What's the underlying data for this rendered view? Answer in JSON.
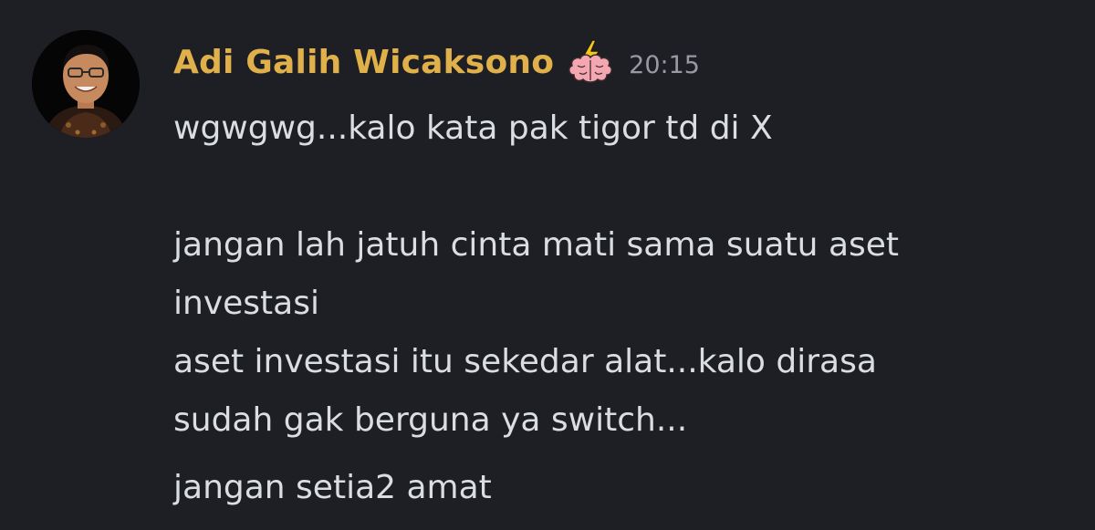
{
  "message": {
    "author": {
      "name": "Adi Galih Wicaksono",
      "name_color": "#e0b04a",
      "avatar_icon": "avatar",
      "role_icon": "brain-lightning-icon"
    },
    "timestamp": "20:15",
    "lines": [
      "wgwgwg...kalo kata pak tigor td di X",
      "",
      "jangan lah jatuh cinta mati sama suatu aset",
      "investasi",
      "aset investasi itu sekedar alat...kalo dirasa",
      "sudah gak berguna ya switch..."
    ],
    "followup": "jangan setia2 amat"
  },
  "colors": {
    "background": "#1e1f24",
    "text": "#dbdee1",
    "timestamp": "#989aa2"
  }
}
